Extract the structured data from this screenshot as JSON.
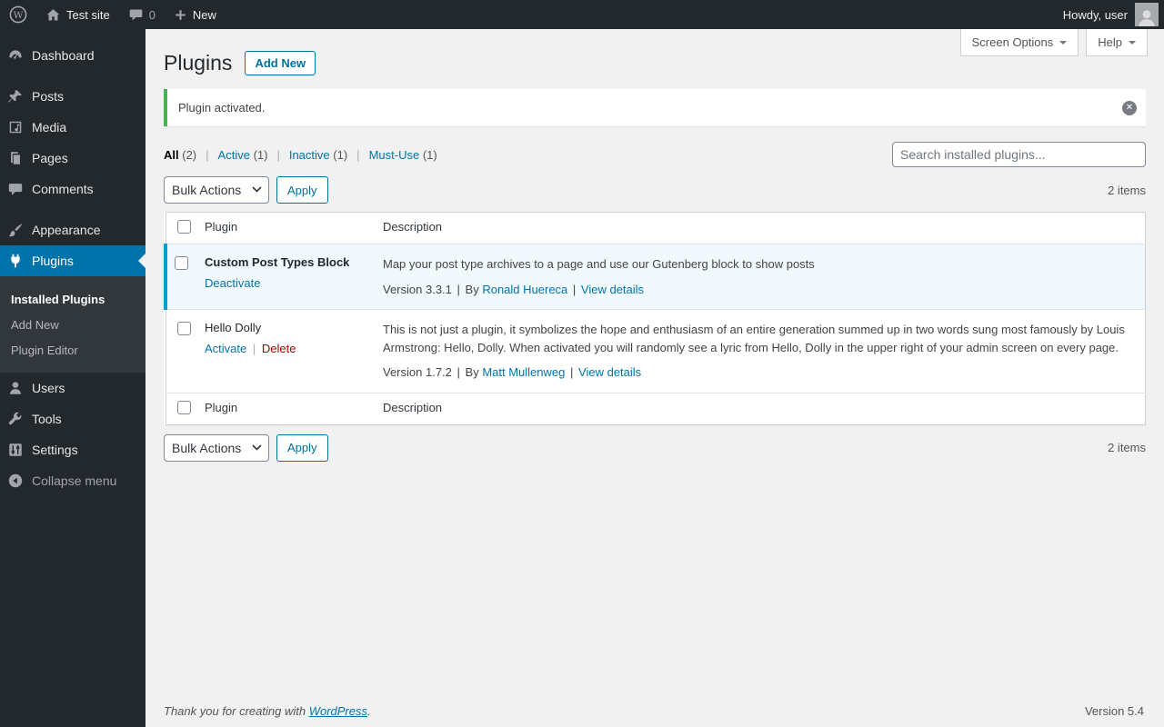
{
  "ui": {
    "separator": "|"
  },
  "colors": {
    "admin_bar_bg": "#23282d",
    "accent_blue": "#0073aa",
    "notice_green": "#46b450",
    "active_row_border": "#00a0d2",
    "active_row_bg": "#f1f9fd",
    "delete_red": "#a00"
  },
  "admin_bar": {
    "site_name": "Test site",
    "comments_count": "0",
    "new_label": "New",
    "howdy_text": "Howdy, user"
  },
  "sidebar": {
    "items": [
      {
        "label": "Dashboard"
      },
      {
        "label": "Posts"
      },
      {
        "label": "Media"
      },
      {
        "label": "Pages"
      },
      {
        "label": "Comments"
      },
      {
        "label": "Appearance"
      },
      {
        "label": "Plugins"
      },
      {
        "label": "Users"
      },
      {
        "label": "Tools"
      },
      {
        "label": "Settings"
      }
    ],
    "plugins_submenu": [
      {
        "label": "Installed Plugins"
      },
      {
        "label": "Add New"
      },
      {
        "label": "Plugin Editor"
      }
    ],
    "collapse_label": "Collapse menu"
  },
  "header": {
    "title": "Plugins",
    "add_new_label": "Add New",
    "screen_options_label": "Screen Options",
    "help_label": "Help"
  },
  "notice": {
    "message": "Plugin activated."
  },
  "filters": {
    "items": [
      {
        "label": "All",
        "count": "(2)"
      },
      {
        "label": "Active",
        "count": "(1)"
      },
      {
        "label": "Inactive",
        "count": "(1)"
      },
      {
        "label": "Must-Use",
        "count": "(1)"
      }
    ]
  },
  "toolbar": {
    "bulk_actions_label": "Bulk Actions",
    "apply_label": "Apply",
    "items_count": "2 items",
    "search_placeholder": "Search installed plugins..."
  },
  "table": {
    "headers": {
      "plugin": "Plugin",
      "description": "Description"
    }
  },
  "plugins": [
    {
      "name": "Custom Post Types Block",
      "action_1": "Deactivate",
      "description": "Map your post type archives to a page and use our Gutenberg block to show posts",
      "version": "Version 3.3.1",
      "by_label": "By",
      "author": "Ronald Huereca",
      "view_details": "View details"
    },
    {
      "name": "Hello Dolly",
      "action_1": "Activate",
      "action_2": "Delete",
      "description": "This is not just a plugin, it symbolizes the hope and enthusiasm of an entire generation summed up in two words sung most famously by Louis Armstrong: Hello, Dolly. When activated you will randomly see a lyric from Hello, Dolly in the upper right of your admin screen on every page.",
      "version": "Version 1.7.2",
      "by_label": "By",
      "author": "Matt Mullenweg",
      "view_details": "View details"
    }
  ],
  "footer": {
    "thanks_prefix": "Thank you for creating with",
    "wordpress_link": "WordPress",
    "thanks_suffix": ".",
    "version": "Version 5.4"
  }
}
